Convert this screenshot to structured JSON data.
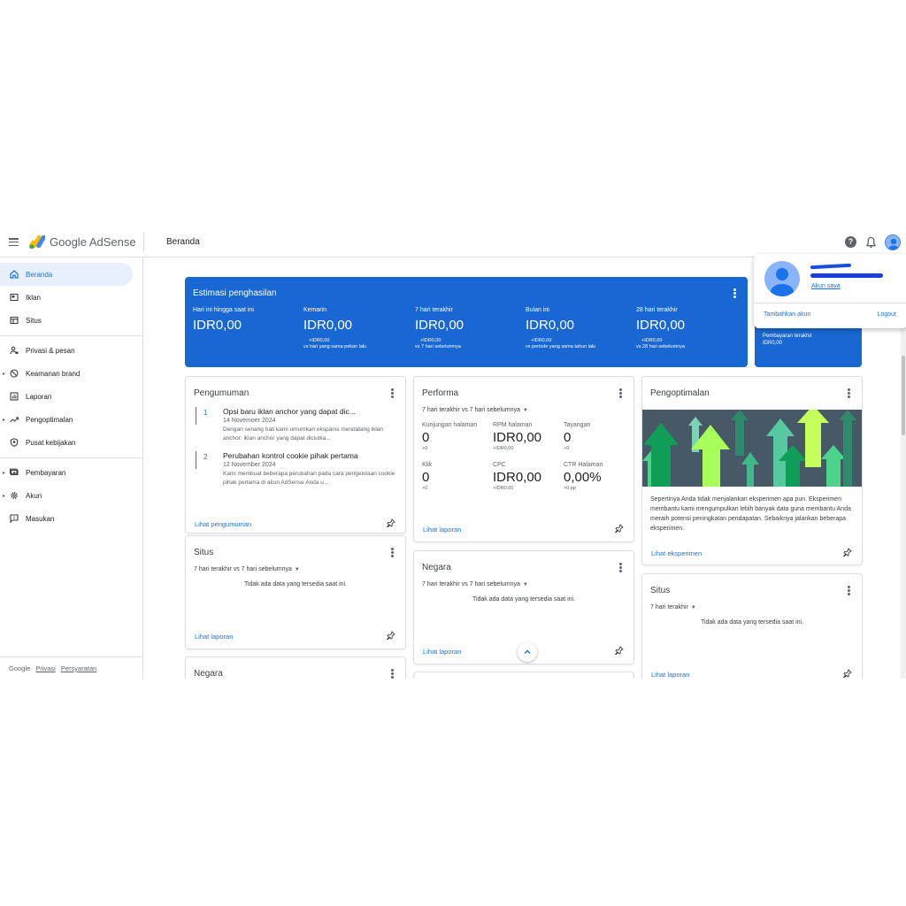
{
  "header": {
    "brand": "Google AdSense",
    "page_title": "Beranda",
    "help_glyph": "?"
  },
  "sidebar": {
    "items": [
      {
        "label": "Beranda",
        "icon": "home-icon",
        "active": true
      },
      {
        "label": "Iklan",
        "icon": "ads-icon"
      },
      {
        "label": "Situs",
        "icon": "sites-icon"
      },
      {
        "label": "Privasi & pesan",
        "icon": "privacy-icon"
      },
      {
        "label": "Keamanan brand",
        "icon": "block-icon"
      },
      {
        "label": "Laporan",
        "icon": "reports-icon"
      },
      {
        "label": "Pengoptimalan",
        "icon": "trending-icon"
      },
      {
        "label": "Pusat kebijakan",
        "icon": "policy-icon"
      },
      {
        "label": "Pembayaran",
        "icon": "payments-icon"
      },
      {
        "label": "Akun",
        "icon": "gear-icon"
      },
      {
        "label": "Masukan",
        "icon": "feedback-icon"
      }
    ],
    "footer": {
      "google": "Google",
      "privacy": "Privasi",
      "terms": "Persyaratan"
    }
  },
  "earnings": {
    "title": "Estimasi penghasilan",
    "columns": [
      {
        "label": "Hari ini hingga saat ini",
        "value": "IDR0,00",
        "change": "",
        "compare": ""
      },
      {
        "label": "Kemarin",
        "value": "IDR0,00",
        "change": "+IDR0,00",
        "compare": "vs hari yang sama pekan lalu"
      },
      {
        "label": "7 hari terakhir",
        "value": "IDR0,00",
        "change": "+IDR0,00",
        "compare": "vs 7 hari sebelumnya"
      },
      {
        "label": "Bulan ini",
        "value": "IDR0,00",
        "change": "+IDR0,00",
        "compare": "vs periode yang sama tahun lalu"
      },
      {
        "label": "28 hari terakhir",
        "value": "IDR0,00",
        "change": "+IDR0,00",
        "compare": "vs 28 hari sebelumnya"
      }
    ]
  },
  "last_payment": {
    "label": "Pembayaran terakhir",
    "value": "IDR0,00"
  },
  "announcements": {
    "title": "Pengumuman",
    "items": [
      {
        "num": "1",
        "title": "Opsi baru iklan anchor yang dapat dic...",
        "date": "14 Novemoer 2024",
        "body": "Dengan senang hati kami umumkan ekspansi mendatang iklan anchor: iklan anchor yang dapat diciutka..."
      },
      {
        "num": "2",
        "title": "Perubahan kontrol cookie pihak pertama",
        "date": "12 November 2024",
        "body": "Kami membuat beberapa perubahan pada cara pengelolaan cookie pihak pertama di akun AdSense Anda u..."
      }
    ],
    "link": "Lihat pengumuman"
  },
  "performance": {
    "title": "Performa",
    "filter": "7 hari terakhir vs 7 hari sebelumnya",
    "metrics": [
      {
        "label": "Kunjungan halaman",
        "value": "0",
        "change": "+0"
      },
      {
        "label": "RPM halaman",
        "value": "IDR0,00",
        "change": "+IDR0,00"
      },
      {
        "label": "Tayangan",
        "value": "0",
        "change": "+0"
      },
      {
        "label": "Klik",
        "value": "0",
        "change": "+0"
      },
      {
        "label": "CPC",
        "value": "IDR0,00",
        "change": "+IDR0,00"
      },
      {
        "label": "CTR Halaman",
        "value": "0,00%",
        "change": "+0 pp"
      }
    ],
    "link": "Lihat laporan"
  },
  "optimization": {
    "title": "Pengoptimalan",
    "text": "Sepertinya Anda tidak menjalankan eksperimen apa pun. Eksperimen membantu kami mengumpulkan lebih banyak data guna membantu Anda meraih potensi peningkatan pendapatan. Sebaiknya jalankan beberapa eksperimen.",
    "link": "Lihat eksperimen"
  },
  "sites_card": {
    "title": "Situs",
    "filter": "7 hari terakhir vs 7 hari sebelumnya",
    "nodata": "Tidak ada data yang tersedia saat ini.",
    "link": "Lihat laporan"
  },
  "countries_card": {
    "title": "Negara",
    "filter": "7 hari terakhir vs 7 hari sebelumnya",
    "nodata": "Tidak ada data yang tersedia saat ini.",
    "link": "Lihat laporan"
  },
  "sites_card_right": {
    "title": "Situs",
    "filter": "7 hari terakhir",
    "nodata": "Tidak ada data yang tersedia saat ini.",
    "link": "Lihat laporan"
  },
  "countries_card_bottom": {
    "title": "Negara"
  },
  "account_popup": {
    "my_account": "Akun saya",
    "add_account": "Tambahkan akun",
    "logout": "Logout"
  },
  "colors": {
    "accent": "#1a73e8",
    "earnings_bg": "#1967d2",
    "active_nav_bg": "#e8f0fe"
  }
}
